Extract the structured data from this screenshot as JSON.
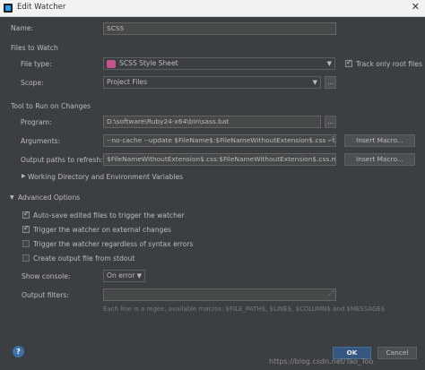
{
  "window": {
    "title": "Edit Watcher",
    "close_glyph": "✕"
  },
  "name": {
    "label": "Name:",
    "value": "SCSS"
  },
  "files_to_watch": {
    "header": "Files to Watch",
    "file_type_label": "File type:",
    "file_type_value": "SCSS Style Sheet",
    "file_type_icon": "scss-file-icon",
    "scope_label": "Scope:",
    "scope_value": "Project Files",
    "scope_browse": "...",
    "track_only_root_label": "Track only root files",
    "track_only_root_checked": true
  },
  "tool": {
    "header": "Tool to Run on Changes",
    "program_label": "Program:",
    "program_value": "D:\\software\\Ruby24-x64\\bin\\sass.bat",
    "program_browse": "...",
    "arguments_label": "Arguments:",
    "arguments_value": "--no-cache --update $FileName$:$FileNameWithoutExtension$.css --trace",
    "insert_macro_label": "Insert Macro...",
    "output_label": "Output paths to refresh:",
    "output_value": "$FileNameWithoutExtension$.css:$FileNameWithoutExtension$.css.map",
    "insert_macro_label_2": "Insert Macro...",
    "working_dir_label": "Working Directory and Environment Variables"
  },
  "advanced": {
    "header": "Advanced Options",
    "options": [
      {
        "label": "Auto-save edited files to trigger the watcher",
        "checked": true
      },
      {
        "label": "Trigger the watcher on external changes",
        "checked": true
      },
      {
        "label": "Trigger the watcher regardless of syntax errors",
        "checked": false
      },
      {
        "label": "Create output file from stdout",
        "checked": false
      }
    ],
    "show_console_label": "Show console:",
    "show_console_value": "On error",
    "output_filters_label": "Output filters:",
    "output_filters_value": "",
    "hint": "Each line is a regex, available macros: $FILE_PATH$, $LINE$, $COLUMN$ and $MESSAGE$"
  },
  "footer": {
    "help": "?",
    "ok": "OK",
    "cancel": "Cancel",
    "watermark": "https://blog.csdn.net/Tao_Too"
  },
  "colors": {
    "background": "#3c3f41",
    "ok_button": "#365880",
    "text": "#bbbbbb"
  }
}
